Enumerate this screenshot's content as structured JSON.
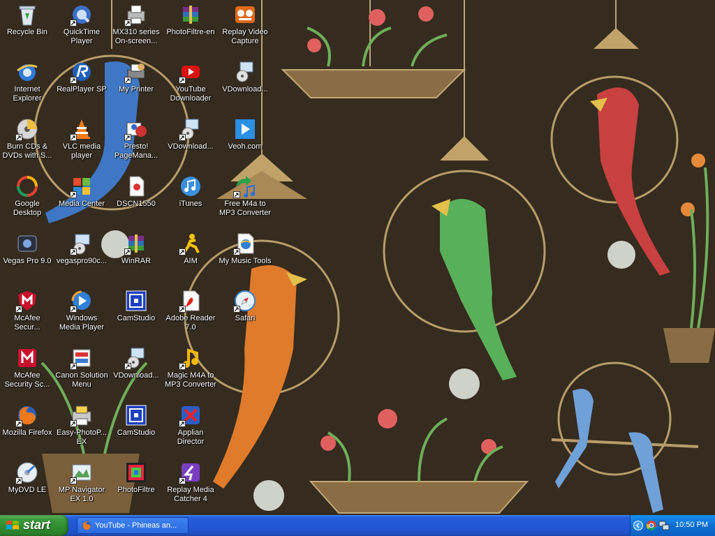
{
  "desktop": {
    "icons": [
      {
        "label": "Recycle Bin",
        "icon": "recycle-bin-icon",
        "shortcut": false
      },
      {
        "label": "Internet Explorer",
        "icon": "internet-explorer-icon",
        "shortcut": false
      },
      {
        "label": "Burn CDs & DVDs with S...",
        "icon": "cd-burn-icon",
        "shortcut": true
      },
      {
        "label": "Google Desktop",
        "icon": "google-desktop-icon",
        "shortcut": false
      },
      {
        "label": "Vegas Pro 9.0",
        "icon": "vegas-pro-icon",
        "shortcut": false
      },
      {
        "label": "McAfee Secur...",
        "icon": "mcafee-icon",
        "shortcut": true
      },
      {
        "label": "McAfee Security Sc...",
        "icon": "mcafee-scan-icon",
        "shortcut": false
      },
      {
        "label": "Mozilla Firefox",
        "icon": "firefox-icon",
        "shortcut": true
      },
      {
        "label": "MyDVD LE",
        "icon": "mydvd-icon",
        "shortcut": true
      },
      {
        "label": "QuickTime Player",
        "icon": "quicktime-icon",
        "shortcut": true
      },
      {
        "label": "RealPlayer SP",
        "icon": "realplayer-icon",
        "shortcut": true
      },
      {
        "label": "VLC media player",
        "icon": "vlc-icon",
        "shortcut": true
      },
      {
        "label": "Media Center",
        "icon": "media-center-icon",
        "shortcut": true
      },
      {
        "label": "vegaspro90c...",
        "icon": "installer-icon",
        "shortcut": true
      },
      {
        "label": "Windows Media Player",
        "icon": "windows-media-player-icon",
        "shortcut": true
      },
      {
        "label": "Canon Solution Menu",
        "icon": "canon-menu-icon",
        "shortcut": true
      },
      {
        "label": "Easy-PhotoP... EX",
        "icon": "easy-photoprint-icon",
        "shortcut": true
      },
      {
        "label": "MP Navigator EX 1.0",
        "icon": "mp-navigator-icon",
        "shortcut": true
      },
      {
        "label": "MX310 series On-screen...",
        "icon": "printer-manual-icon",
        "shortcut": true
      },
      {
        "label": "My Printer",
        "icon": "my-printer-icon",
        "shortcut": true
      },
      {
        "label": "Presto! PageMana...",
        "icon": "presto-icon",
        "shortcut": true
      },
      {
        "label": "DSCN1550",
        "icon": "image-file-icon",
        "shortcut": false
      },
      {
        "label": "WinRAR",
        "icon": "winrar-icon",
        "shortcut": true
      },
      {
        "label": "CamStudio",
        "icon": "camstudio-icon",
        "shortcut": false
      },
      {
        "label": "VDownload...",
        "icon": "vdownload-icon",
        "shortcut": true
      },
      {
        "label": "CamStudio",
        "icon": "camstudio-icon",
        "shortcut": false
      },
      {
        "label": "PhotoFiltre",
        "icon": "photofiltre-icon",
        "shortcut": false
      },
      {
        "label": "PhotoFiltre-en",
        "icon": "winrar-archive-icon",
        "shortcut": false
      },
      {
        "label": "YouTube Downloader",
        "icon": "youtube-downloader-icon",
        "shortcut": true
      },
      {
        "label": "VDownload...",
        "icon": "vdownload-icon",
        "shortcut": true
      },
      {
        "label": "iTunes",
        "icon": "itunes-icon",
        "shortcut": false
      },
      {
        "label": "AIM",
        "icon": "aim-icon",
        "shortcut": true
      },
      {
        "label": "Adobe Reader 7.0",
        "icon": "adobe-reader-icon",
        "shortcut": true
      },
      {
        "label": "Magic M4A to MP3 Converter",
        "icon": "magic-m4a-icon",
        "shortcut": true
      },
      {
        "label": "Applian Director",
        "icon": "applian-director-icon",
        "shortcut": true
      },
      {
        "label": "Replay Media Catcher 4",
        "icon": "replay-media-catcher-icon",
        "shortcut": true
      },
      {
        "label": "Replay Video Capture",
        "icon": "replay-video-capture-icon",
        "shortcut": false
      },
      {
        "label": "VDownload...",
        "icon": "vdownload-icon",
        "shortcut": false
      },
      {
        "label": "Veoh.com",
        "icon": "veoh-icon",
        "shortcut": false
      },
      {
        "label": "Free M4a to MP3 Converter",
        "icon": "free-m4a-converter-icon",
        "shortcut": true
      },
      {
        "label": "My Music Tools",
        "icon": "music-tools-icon",
        "shortcut": true
      },
      {
        "label": "Safari",
        "icon": "safari-icon",
        "shortcut": true
      }
    ]
  },
  "taskbar": {
    "start_label": "start",
    "tasks": [
      {
        "label": "YouTube - Phineas an...",
        "icon": "firefox-icon"
      }
    ],
    "tray": {
      "time": "10:50 PM",
      "icons": [
        "show-hidden-icons-icon",
        "chrome-icon",
        "network-icon"
      ]
    }
  },
  "colors": {
    "taskbar_blue": "#245edc",
    "start_green": "#3c9b3c",
    "tray_blue": "#0c6fd6"
  }
}
